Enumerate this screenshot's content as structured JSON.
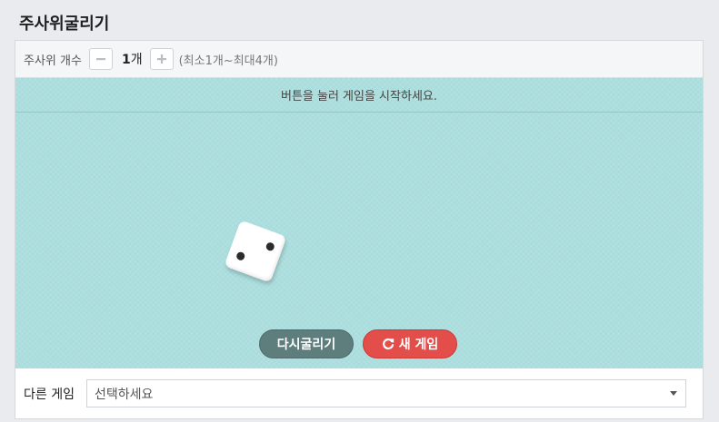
{
  "title": "주사위굴리기",
  "count": {
    "label": "주사위 개수",
    "value_number": "1",
    "value_unit": "개",
    "range": "(최소1개~최대4개)",
    "decrement_icon": "minus-icon",
    "increment_icon": "plus-icon"
  },
  "board": {
    "message": "버튼을 눌러 게임을 시작하세요.",
    "background_color": "#a9dcdc",
    "dice": [
      {
        "face": 2
      }
    ]
  },
  "buttons": {
    "reroll_label": "다시굴리기",
    "new_game_label": "새 게임",
    "new_game_icon": "refresh-icon",
    "reroll_color": "#5e7e7e",
    "new_game_color": "#e44e4a"
  },
  "other_games": {
    "label": "다른 게임",
    "select_value": "선택하세요"
  }
}
